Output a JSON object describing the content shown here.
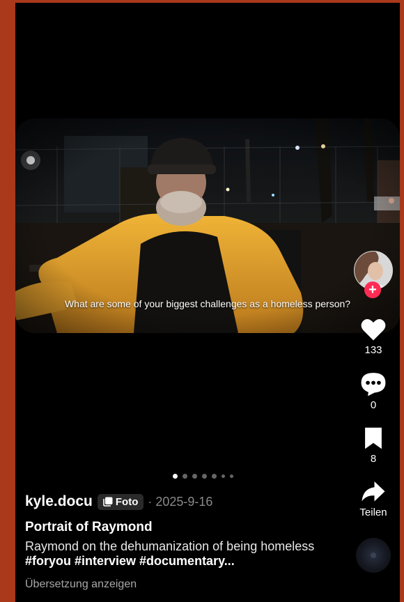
{
  "post": {
    "subtitle": "What are some of your biggest challenges as a homeless person?",
    "author": "kyle.docu",
    "badge_label": "Foto",
    "date": "· 2025-9-16",
    "title": "Portrait of Raymond",
    "description_text": "Raymond on the dehumanization of being homeless ",
    "hashtags": "#foryou #interview #documentary...",
    "translate_label": "Übersetzung anzeigen",
    "carousel": {
      "count": 7,
      "active": 1
    }
  },
  "actions": {
    "likes": "133",
    "comments": "0",
    "saves": "8",
    "share_label": "Teilen"
  },
  "icons": {
    "follow": "plus-icon",
    "like": "heart-icon",
    "comment": "comment-bubble-icon",
    "save": "bookmark-icon",
    "share": "share-arrow-icon",
    "photo_badge": "photo-stack-icon",
    "music": "music-disc-icon"
  },
  "colors": {
    "background": "#000000",
    "frame": "#a9391a",
    "follow_badge": "#fe2c55",
    "jacket": "#e0a12e"
  }
}
